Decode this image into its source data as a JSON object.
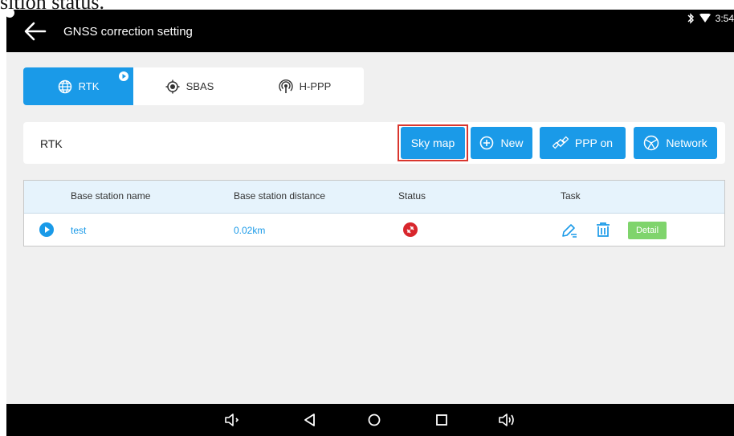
{
  "caption": {
    "text": "sition status."
  },
  "status_bar": {
    "time": "3:54",
    "bluetooth": "bluetooth-icon",
    "wifi": "wifi-icon"
  },
  "header": {
    "back_icon": "arrow-left-icon",
    "title": "GNSS correction setting"
  },
  "tabs": [
    {
      "label": "RTK",
      "icon": "globe-icon",
      "active": true
    },
    {
      "label": "SBAS",
      "icon": "target-icon",
      "active": false
    },
    {
      "label": "H-PPP",
      "icon": "antenna-icon",
      "active": false
    }
  ],
  "rtk_bar": {
    "label": "RTK",
    "buttons": [
      {
        "label": "Sky map",
        "highlighted": true
      },
      {
        "label": "New",
        "icon": "plus-circle-icon"
      },
      {
        "label": "PPP on",
        "icon": "satellite-icon"
      },
      {
        "label": "Network",
        "icon": "network-globe-icon"
      }
    ]
  },
  "table": {
    "columns": [
      "Base station name",
      "Base station distance",
      "Status",
      "Task"
    ],
    "rows": [
      {
        "name": "test",
        "distance": "0.02km",
        "status": "disconnected-icon",
        "detail_label": "Detail"
      }
    ]
  },
  "nav_bar": {
    "icons": [
      "volume-down-icon",
      "back-triangle-icon",
      "home-circle-icon",
      "recents-square-icon",
      "volume-up-icon"
    ]
  },
  "colors": {
    "accent": "#1a9ae8",
    "highlight": "#d9362e",
    "detail": "#7fd46c",
    "status_red": "#d8262c",
    "bar": "#000000"
  }
}
